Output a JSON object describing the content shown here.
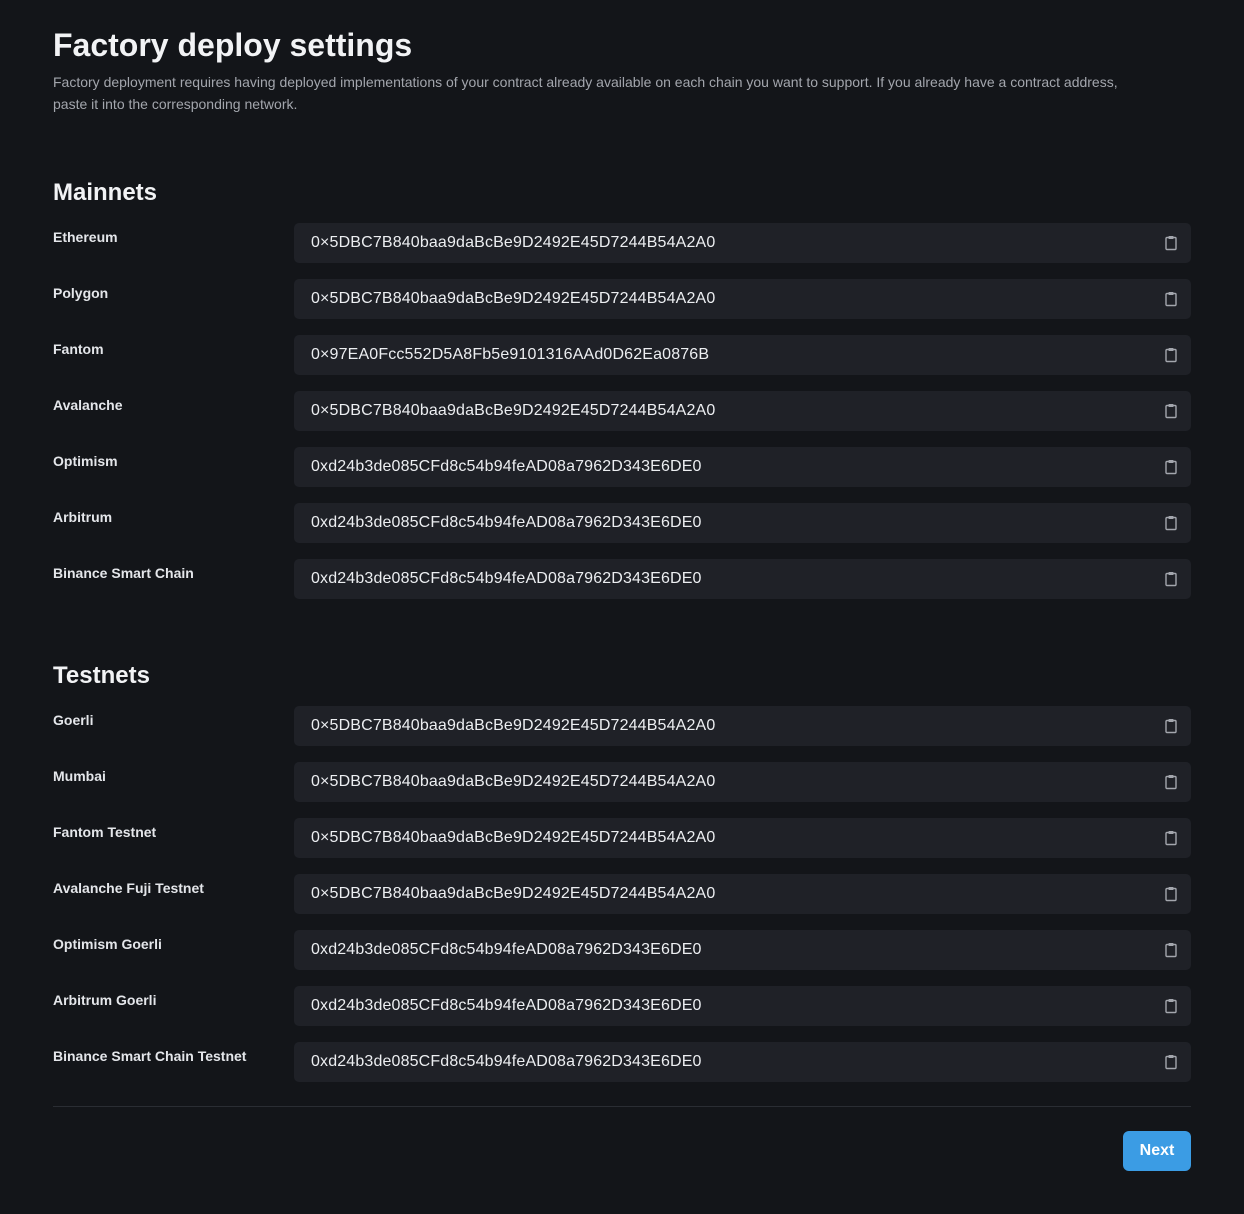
{
  "page": {
    "title": "Factory deploy settings",
    "description": "Factory deployment requires having deployed implementations of your contract already available on each chain you want to support. If you already have a contract address, paste it into the corresponding network."
  },
  "mainnets": {
    "title": "Mainnets",
    "networks": [
      {
        "label": "Ethereum",
        "address": "0×5DBC7B840baa9daBcBe9D2492E45D7244B54A2A0"
      },
      {
        "label": "Polygon",
        "address": "0×5DBC7B840baa9daBcBe9D2492E45D7244B54A2A0"
      },
      {
        "label": "Fantom",
        "address": "0×97EA0Fcc552D5A8Fb5e9101316AAd0D62Ea0876B"
      },
      {
        "label": "Avalanche",
        "address": "0×5DBC7B840baa9daBcBe9D2492E45D7244B54A2A0"
      },
      {
        "label": "Optimism",
        "address": "0xd24b3de085CFd8c54b94feAD08a7962D343E6DE0"
      },
      {
        "label": "Arbitrum",
        "address": "0xd24b3de085CFd8c54b94feAD08a7962D343E6DE0"
      },
      {
        "label": "Binance Smart Chain",
        "address": "0xd24b3de085CFd8c54b94feAD08a7962D343E6DE0"
      }
    ]
  },
  "testnets": {
    "title": "Testnets",
    "networks": [
      {
        "label": "Goerli",
        "address": "0×5DBC7B840baa9daBcBe9D2492E45D7244B54A2A0"
      },
      {
        "label": "Mumbai",
        "address": "0×5DBC7B840baa9daBcBe9D2492E45D7244B54A2A0"
      },
      {
        "label": "Fantom Testnet",
        "address": "0×5DBC7B840baa9daBcBe9D2492E45D7244B54A2A0"
      },
      {
        "label": "Avalanche Fuji Testnet",
        "address": "0×5DBC7B840baa9daBcBe9D2492E45D7244B54A2A0"
      },
      {
        "label": "Optimism Goerli",
        "address": "0xd24b3de085CFd8c54b94feAD08a7962D343E6DE0"
      },
      {
        "label": "Arbitrum Goerli",
        "address": "0xd24b3de085CFd8c54b94feAD08a7962D343E6DE0"
      },
      {
        "label": "Binance Smart Chain Testnet",
        "address": "0xd24b3de085CFd8c54b94feAD08a7962D343E6DE0"
      }
    ]
  },
  "footer": {
    "next_label": "Next"
  },
  "icons": {
    "copy": "clipboard-icon"
  },
  "colors": {
    "background": "#131519",
    "field": "#1f2127",
    "accent": "#3b9ce4"
  }
}
